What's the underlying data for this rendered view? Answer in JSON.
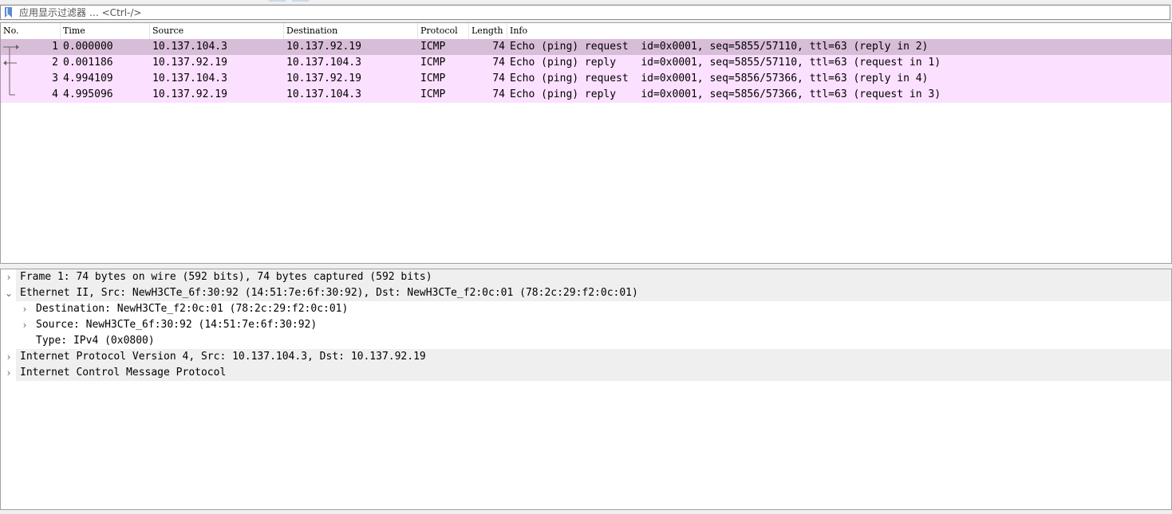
{
  "filter": {
    "placeholder": "应用显示过滤器 … <Ctrl-/>"
  },
  "packet_list": {
    "columns": [
      "No.",
      "Time",
      "Source",
      "Destination",
      "Protocol",
      "Length",
      "Info"
    ],
    "rows": [
      {
        "no": "1",
        "time": "0.000000",
        "source": "10.137.104.3",
        "destination": "10.137.92.19",
        "protocol": "ICMP",
        "length": "74",
        "info": "Echo (ping) request  id=0x0001, seq=5855/57110, ttl=63 (reply in 2)",
        "selected": true
      },
      {
        "no": "2",
        "time": "0.001186",
        "source": "10.137.92.19",
        "destination": "10.137.104.3",
        "protocol": "ICMP",
        "length": "74",
        "info": "Echo (ping) reply    id=0x0001, seq=5855/57110, ttl=63 (request in 1)",
        "selected": false
      },
      {
        "no": "3",
        "time": "4.994109",
        "source": "10.137.104.3",
        "destination": "10.137.92.19",
        "protocol": "ICMP",
        "length": "74",
        "info": "Echo (ping) request  id=0x0001, seq=5856/57366, ttl=63 (reply in 4)",
        "selected": false
      },
      {
        "no": "4",
        "time": "4.995096",
        "source": "10.137.92.19",
        "destination": "10.137.104.3",
        "protocol": "ICMP",
        "length": "74",
        "info": "Echo (ping) reply    id=0x0001, seq=5856/57366, ttl=63 (request in 3)",
        "selected": false
      }
    ]
  },
  "details": {
    "items": [
      {
        "text": "Frame 1: 74 bytes on wire (592 bits), 74 bytes captured (592 bits)",
        "expander": "collapsed"
      },
      {
        "text": "Ethernet II, Src: NewH3CTe_6f:30:92 (14:51:7e:6f:30:92), Dst: NewH3CTe_f2:0c:01 (78:2c:29:f2:0c:01)",
        "expander": "expanded"
      },
      {
        "text": "Destination: NewH3CTe_f2:0c:01 (78:2c:29:f2:0c:01)",
        "expander": "collapsed"
      },
      {
        "text": "Source: NewH3CTe_6f:30:92 (14:51:7e:6f:30:92)",
        "expander": "collapsed"
      },
      {
        "text": "Type: IPv4 (0x0800)",
        "expander": "none"
      },
      {
        "text": "Internet Protocol Version 4, Src: 10.137.104.3, Dst: 10.137.92.19",
        "expander": "collapsed"
      },
      {
        "text": "Internet Control Message Protocol",
        "expander": "collapsed"
      }
    ]
  },
  "colors": {
    "row_bg": "#fce0ff",
    "row_selected_bg": "#d8bdd9"
  }
}
